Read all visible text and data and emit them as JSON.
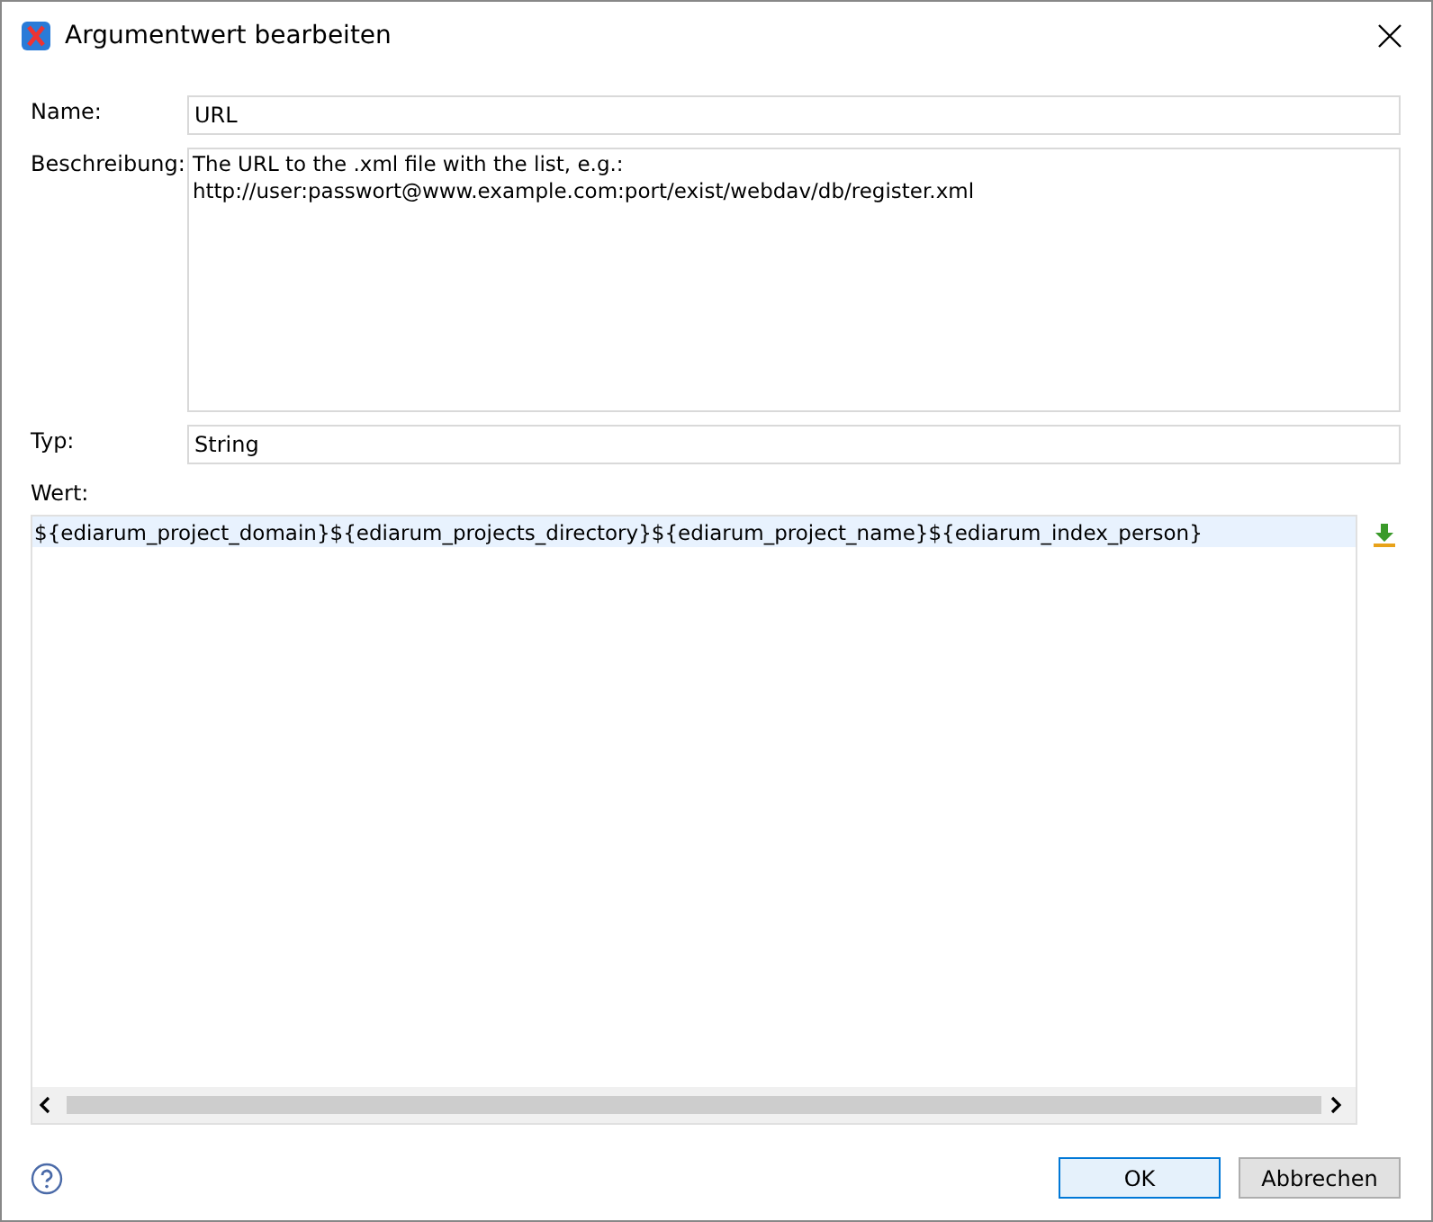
{
  "window": {
    "title": "Argumentwert bearbeiten"
  },
  "fields": [
    {
      "label": "Name:",
      "kind": "input",
      "value": "URL"
    },
    {
      "label": "Beschreibung:",
      "kind": "textarea",
      "value": "The URL to the .xml file with the list, e.g.:\nhttp://user:passwort@www.example.com:port/exist/webdav/db/register.xml"
    },
    {
      "label": "Typ:",
      "kind": "input",
      "value": "String"
    }
  ],
  "value_editor": {
    "label": "Wert:",
    "value": "${ediarum_project_domain}${ediarum_projects_directory}${ediarum_project_name}${ediarum_index_person}"
  },
  "buttons": [
    {
      "label": "OK",
      "selected": true
    },
    {
      "label": "Abbrechen",
      "selected": false
    }
  ]
}
